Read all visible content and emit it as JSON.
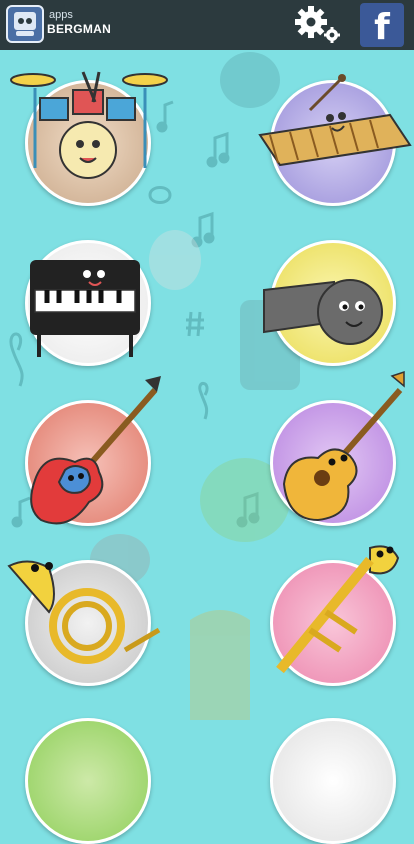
{
  "header": {
    "logo_small": "apps",
    "logo_big": "BERGMAN",
    "settings_icon": "gear-icon",
    "facebook_icon": "facebook-icon",
    "facebook_glyph": "f"
  },
  "colors": {
    "background": "#7fe0e3",
    "topbar": "#2c3a3e",
    "facebook": "#3b5998"
  },
  "instruments": [
    {
      "name": "drums",
      "color": "#e0c6ad"
    },
    {
      "name": "xylophone",
      "color": "#b9b2e8"
    },
    {
      "name": "piano",
      "color": "#ffffff"
    },
    {
      "name": "whistle",
      "color": "#f2ec7f"
    },
    {
      "name": "electric-guitar",
      "color": "#ef9a8c"
    },
    {
      "name": "acoustic-guitar",
      "color": "#c8a0e6"
    },
    {
      "name": "french-horn",
      "color": "#d7d7d7"
    },
    {
      "name": "trumpet",
      "color": "#f4a7c4"
    }
  ]
}
